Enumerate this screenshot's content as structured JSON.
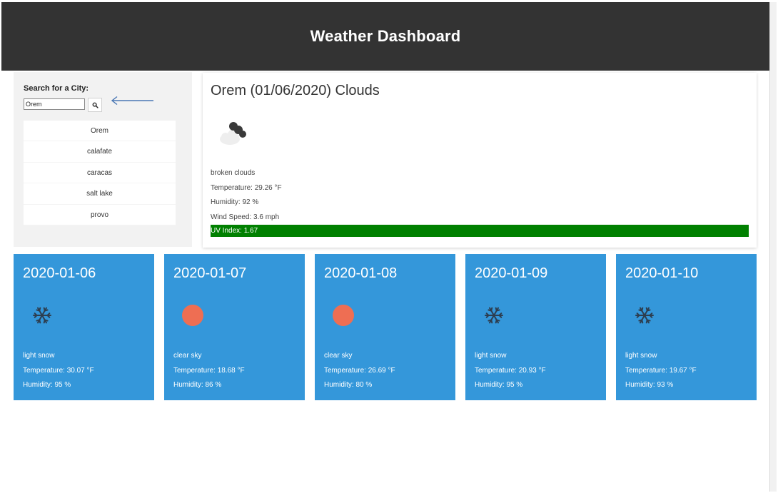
{
  "header": {
    "title": "Weather Dashboard"
  },
  "search": {
    "label": "Search for a City:",
    "value": "Orem",
    "button_icon": "search-icon"
  },
  "history": [
    "Orem",
    "calafate",
    "caracas",
    "salt lake",
    "provo"
  ],
  "current": {
    "title": "Orem (01/06/2020) Clouds",
    "icon": "broken-clouds-icon",
    "description": "broken clouds",
    "temperature": "Temperature: 29.26 °F",
    "humidity": "Humidity: 92 %",
    "wind": "Wind Speed: 3.6 mph",
    "uv": "UV Index: 1.67",
    "uv_color": "#008000"
  },
  "forecast": [
    {
      "date": "2020-01-06",
      "icon": "snowflake-icon",
      "description": "light snow",
      "temperature": "Temperature: 30.07 °F",
      "humidity": "Humidity: 95 %"
    },
    {
      "date": "2020-01-07",
      "icon": "sun-icon",
      "description": "clear sky",
      "temperature": "Temperature: 18.68 °F",
      "humidity": "Humidity: 86 %"
    },
    {
      "date": "2020-01-08",
      "icon": "sun-icon",
      "description": "clear sky",
      "temperature": "Temperature: 26.69 °F",
      "humidity": "Humidity: 80 %"
    },
    {
      "date": "2020-01-09",
      "icon": "snowflake-icon",
      "description": "light snow",
      "temperature": "Temperature: 20.93 °F",
      "humidity": "Humidity: 95 %"
    },
    {
      "date": "2020-01-10",
      "icon": "snowflake-icon",
      "description": "light snow",
      "temperature": "Temperature: 19.67 °F",
      "humidity": "Humidity: 93 %"
    }
  ],
  "colors": {
    "header_bg": "#333333",
    "sidebar_bg": "#f2f2f2",
    "card_bg": "#3497da",
    "sun": "#ee6e53",
    "uv_bar": "#008000",
    "annotation_arrow": "#4a77b4"
  }
}
